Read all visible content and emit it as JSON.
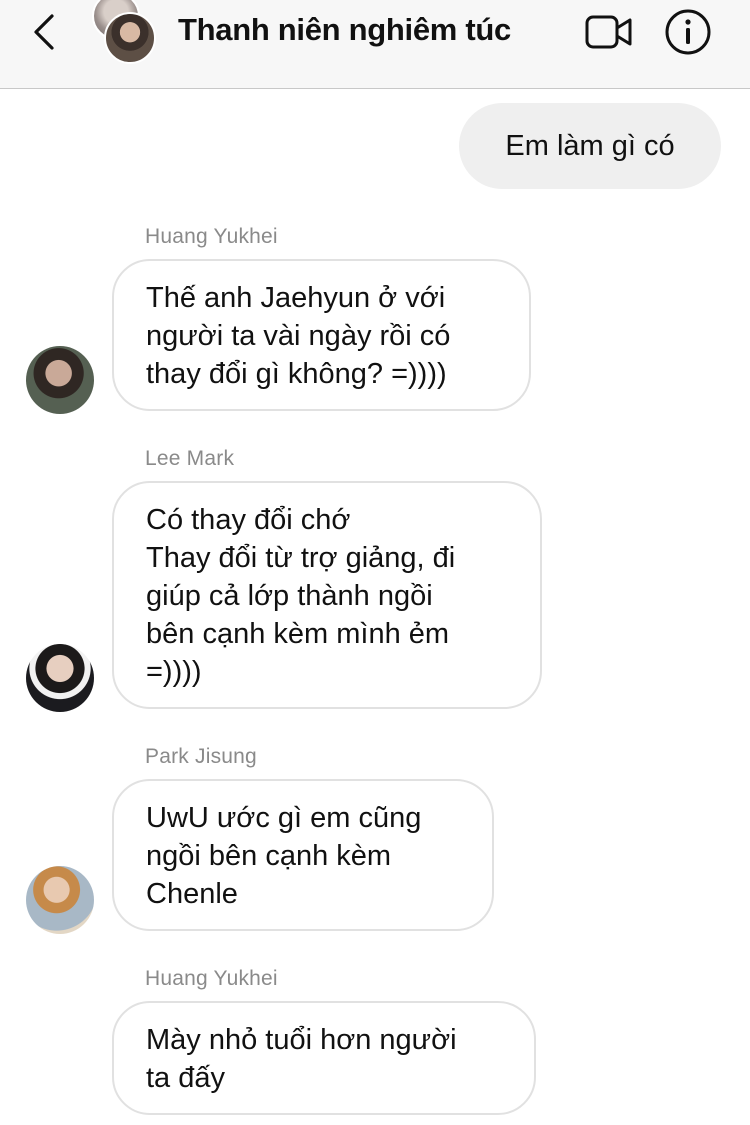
{
  "header": {
    "title": "Thanh niên nghiêm túc",
    "icons": {
      "back": "chevron-left-icon",
      "video": "video-call-icon",
      "info": "info-icon"
    }
  },
  "messages": [
    {
      "direction": "outgoing",
      "text": "Em làm gì có"
    },
    {
      "direction": "incoming",
      "sender": "Huang Yukhei",
      "text": "Thế anh Jaehyun ở với\nngười ta vài ngày rồi có\nthay đổi gì không? =))))"
    },
    {
      "direction": "incoming",
      "sender": "Lee Mark",
      "text": "Có thay đổi chớ\nThay đổi từ trợ giảng, đi\ngiúp cả lớp thành ngồi\nbên cạnh kèm mình ẻm\n=))))"
    },
    {
      "direction": "incoming",
      "sender": "Park Jisung",
      "text": "UwU ước gì em cũng\nngồi bên cạnh kèm\nChenle"
    },
    {
      "direction": "incoming",
      "sender": "Huang Yukhei",
      "text": "Mày nhỏ tuổi hơn người\nta đấy"
    }
  ]
}
